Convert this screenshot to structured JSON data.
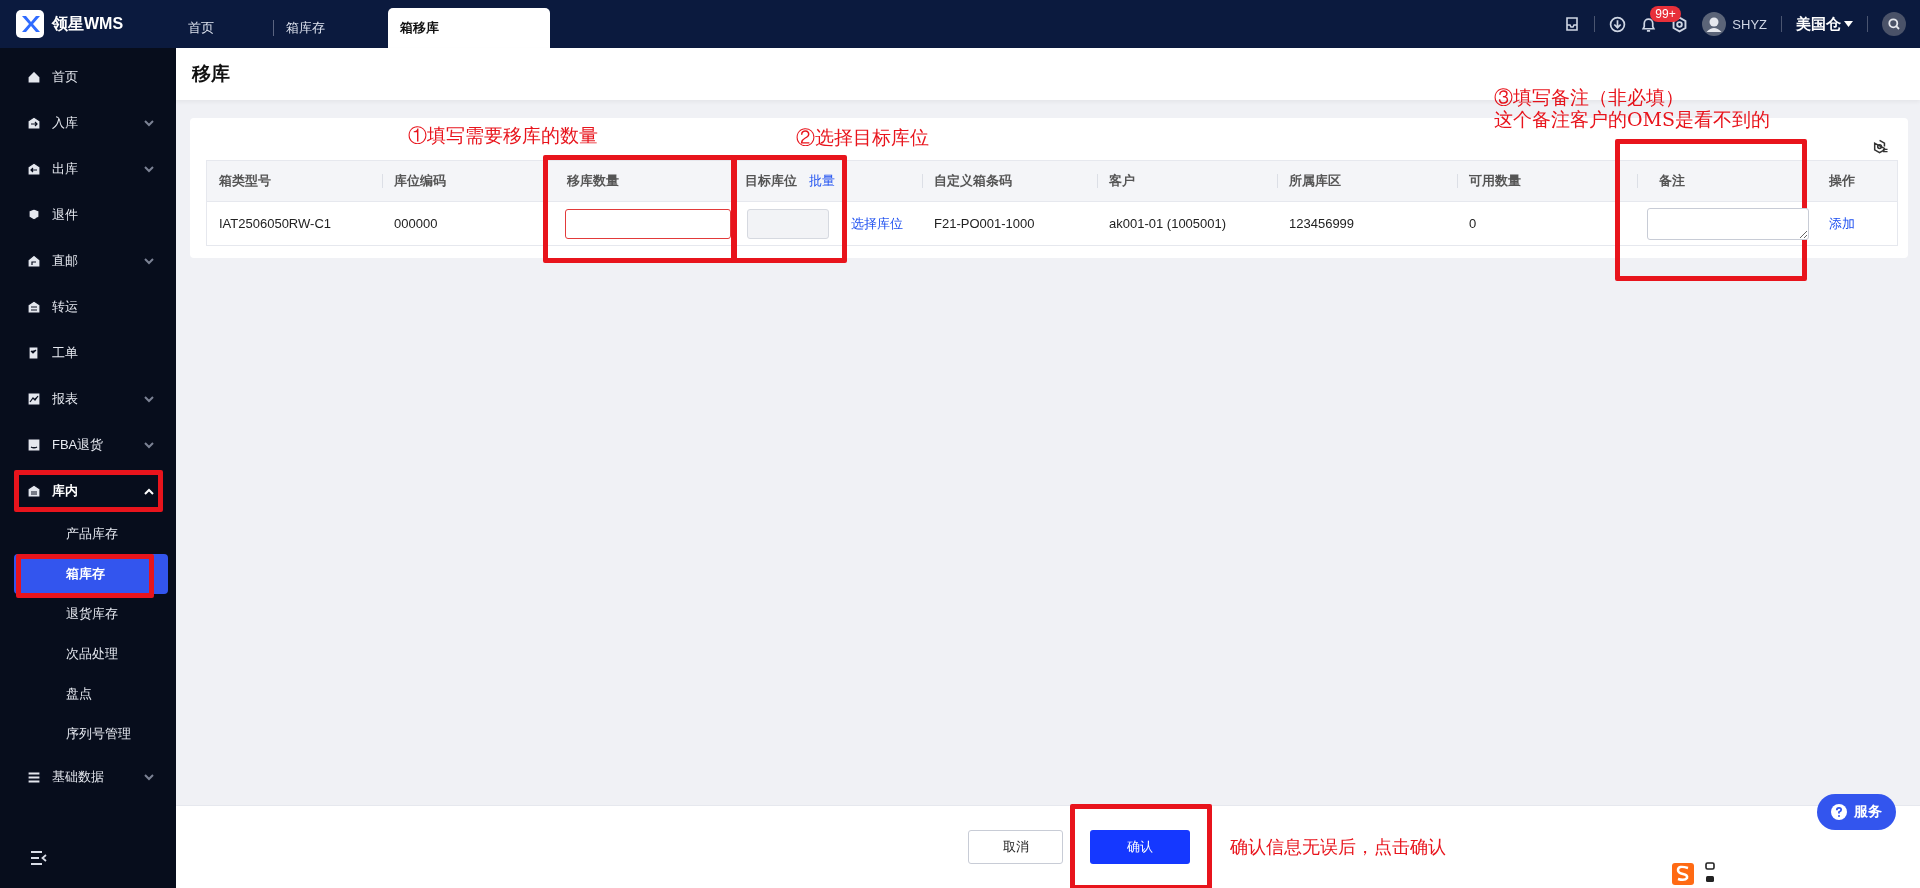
{
  "app": {
    "logo_text": "领星WMS"
  },
  "tabs": [
    {
      "label": "首页",
      "selected": false
    },
    {
      "label": "箱库存",
      "selected": false
    },
    {
      "label": "箱移库",
      "selected": true
    }
  ],
  "header": {
    "notification_count": "99+",
    "user": "SHYZ",
    "warehouse": "美国仓"
  },
  "sidebar": {
    "items": [
      {
        "label": "首页",
        "expandable": false,
        "expanded": false,
        "highlighted": false
      },
      {
        "label": "入库",
        "expandable": true,
        "expanded": false,
        "highlighted": false
      },
      {
        "label": "出库",
        "expandable": true,
        "expanded": false,
        "highlighted": false
      },
      {
        "label": "退件",
        "expandable": false,
        "expanded": false,
        "highlighted": false
      },
      {
        "label": "直邮",
        "expandable": true,
        "expanded": false,
        "highlighted": false
      },
      {
        "label": "转运",
        "expandable": false,
        "expanded": false,
        "highlighted": false
      },
      {
        "label": "工单",
        "expandable": false,
        "expanded": false,
        "highlighted": false
      },
      {
        "label": "报表",
        "expandable": true,
        "expanded": false,
        "highlighted": false
      },
      {
        "label": "FBA退货",
        "expandable": true,
        "expanded": false,
        "highlighted": false
      },
      {
        "label": "库内",
        "expandable": true,
        "expanded": true,
        "highlighted": true,
        "children": [
          {
            "label": "产品库存",
            "selected": false,
            "highlighted": false
          },
          {
            "label": "箱库存",
            "selected": true,
            "highlighted": true
          },
          {
            "label": "退货库存",
            "selected": false,
            "highlighted": false
          },
          {
            "label": "次品处理",
            "selected": false,
            "highlighted": false
          },
          {
            "label": "盘点",
            "selected": false,
            "highlighted": false
          },
          {
            "label": "序列号管理",
            "selected": false,
            "highlighted": false
          }
        ]
      },
      {
        "label": "基础数据",
        "expandable": true,
        "expanded": false,
        "highlighted": false
      }
    ]
  },
  "page_title": "移库",
  "table": {
    "columns": [
      {
        "label": "箱类型号",
        "highlighted": false
      },
      {
        "label": "库位编码",
        "highlighted": false
      },
      {
        "label": "移库数量",
        "highlighted": true
      },
      {
        "label": "目标库位",
        "action": "批量",
        "highlighted": true
      },
      {
        "label": "自定义箱条码",
        "highlighted": false
      },
      {
        "label": "客户",
        "highlighted": false
      },
      {
        "label": "所属库区",
        "highlighted": false
      },
      {
        "label": "可用数量",
        "highlighted": false
      },
      {
        "label": "备注",
        "highlighted": true
      },
      {
        "label": "操作",
        "highlighted": false
      }
    ],
    "rows": [
      {
        "box_type": "IAT2506050RW-C1",
        "location_code": "000000",
        "quantity_invalid": true,
        "select_location": "选择库位",
        "custom_barcode": "F21-PO001-1000",
        "customer": "ak001-01 (1005001)",
        "zone": "123456999",
        "available": "0",
        "action": "添加"
      }
    ]
  },
  "annotations": [
    {
      "lines": [
        "①填写需要移库的数量"
      ]
    },
    {
      "lines": [
        "②选择目标库位"
      ]
    },
    {
      "lines": [
        "③填写备注（非必填）",
        "这个备注客户的OMS是看不到的"
      ]
    },
    {
      "lines": [
        "确认信息无误后，点击确认"
      ]
    }
  ],
  "footer": {
    "cancel": "取消",
    "confirm": "确认",
    "confirm_highlighted": true
  },
  "service_button": "服务"
}
